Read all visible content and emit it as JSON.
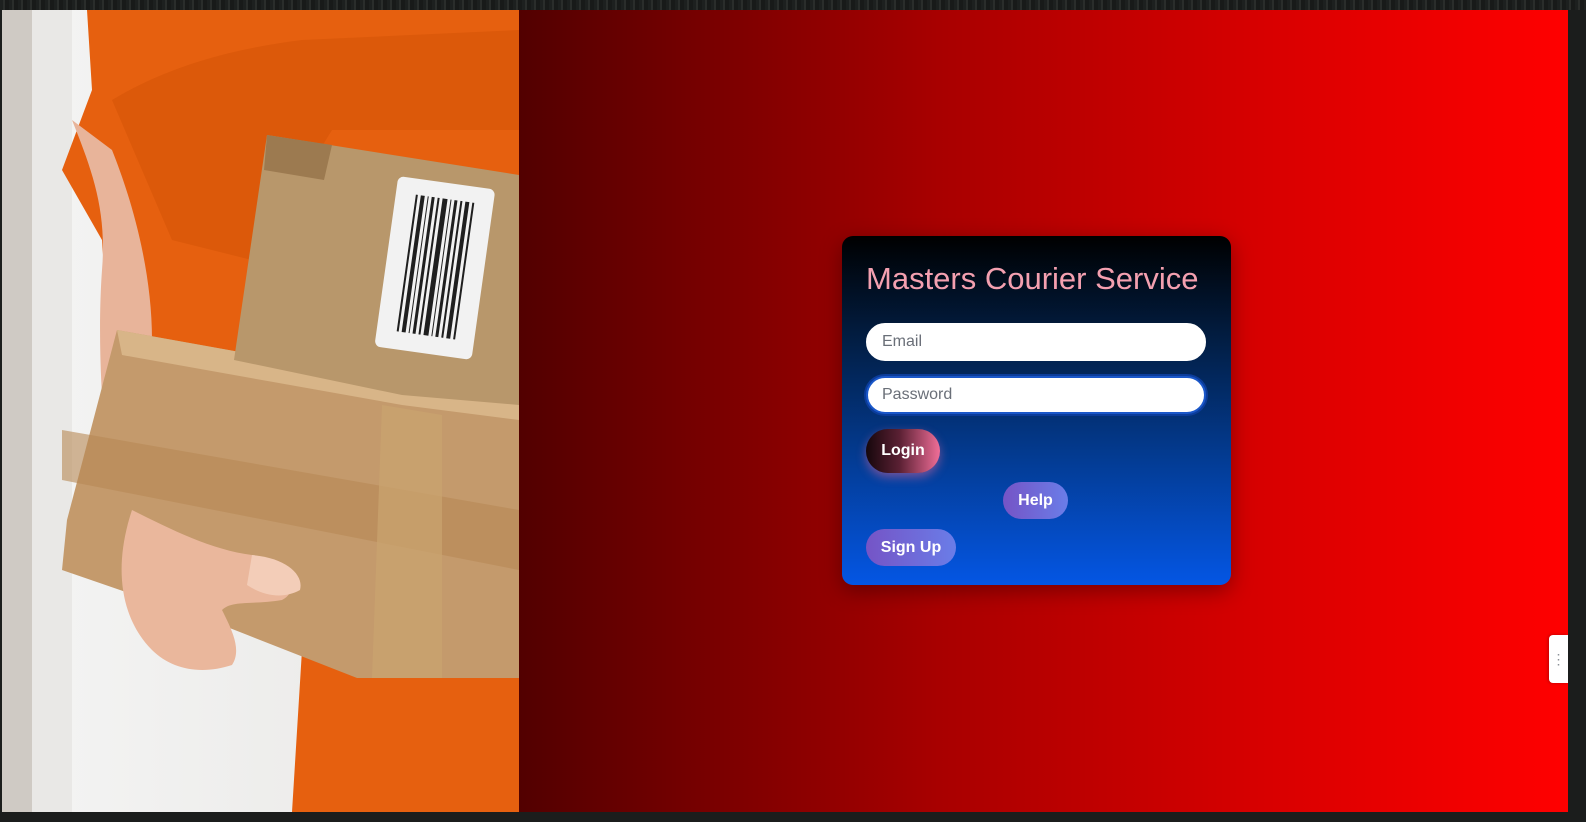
{
  "app": {
    "title": "Masters Courier Service"
  },
  "photo": {
    "icon": "courier-with-boxes-photo"
  },
  "login": {
    "email_placeholder": "Email",
    "password_placeholder": "Password",
    "login_label": "Login",
    "help_label": "Help",
    "signup_label": "Sign Up"
  },
  "side_tab": {
    "icon": "collapse-handle-icon",
    "glyph": "⋮"
  },
  "colors": {
    "hero_gradient_start": "#520000",
    "hero_gradient_end": "#ff0000",
    "card_top": "#000000",
    "card_bottom": "#0456e4",
    "title_color": "#f4a0b0",
    "login_accent": "#f06e98",
    "secondary_button": "#7554c6"
  }
}
